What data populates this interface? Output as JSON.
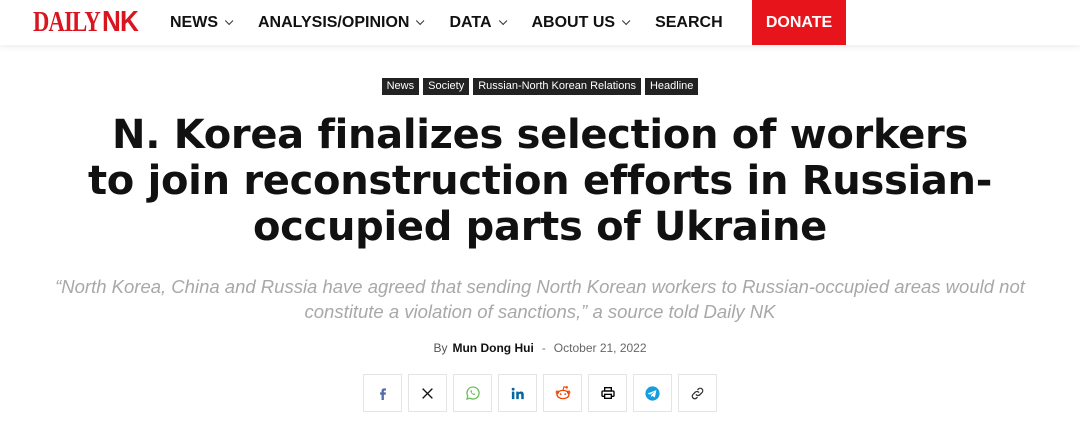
{
  "header": {
    "logo": {
      "part1": "DAILY",
      "part2": "NK"
    },
    "nav": [
      {
        "label": "NEWS",
        "dropdown": true
      },
      {
        "label": "ANALYSIS/OPINION",
        "dropdown": true
      },
      {
        "label": "DATA",
        "dropdown": true
      },
      {
        "label": "ABOUT US",
        "dropdown": true
      },
      {
        "label": "SEARCH",
        "dropdown": false
      }
    ],
    "donate_label": "DONATE",
    "accent_color": "#e8141b"
  },
  "article": {
    "tags": [
      "News",
      "Society",
      "Russian-North Korean Relations",
      "Headline"
    ],
    "title_lines": [
      "N. Korea finalizes selection of workers",
      "to join reconstruction efforts in Russian-",
      "occupied parts of Ukraine"
    ],
    "subtitle_lines": [
      "“North Korea, China and Russia have agreed that sending North Korean workers to Russian-occupied areas would not",
      "constitute a violation of sanctions,” a source told Daily NK"
    ],
    "byline": {
      "by": "By",
      "author": "Mun Dong Hui",
      "separator": "-",
      "date": "October 21, 2022"
    }
  },
  "share_buttons": [
    {
      "icon": "facebook-icon",
      "color": "#516eab"
    },
    {
      "icon": "x-twitter-icon",
      "color": "#111111"
    },
    {
      "icon": "whatsapp-icon",
      "color": "#7bbf6a"
    },
    {
      "icon": "linkedin-icon",
      "color": "#0266a0"
    },
    {
      "icon": "reddit-icon",
      "color": "#f54200"
    },
    {
      "icon": "print-icon",
      "color": "#000000"
    },
    {
      "icon": "telegram-icon",
      "color": "#179cde"
    },
    {
      "icon": "copy-link-icon",
      "color": "#333333"
    }
  ]
}
